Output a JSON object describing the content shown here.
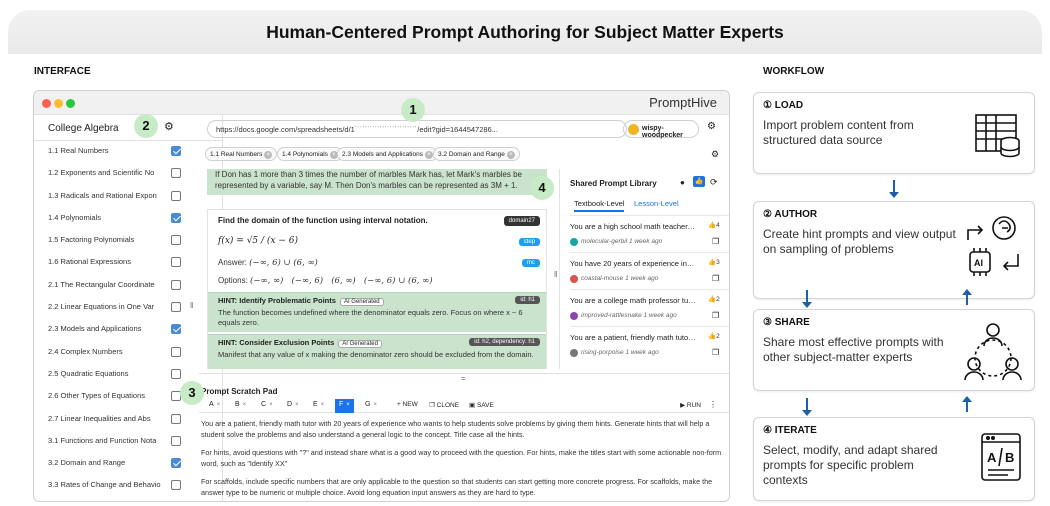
{
  "banner": {
    "title": "Human-Centered Prompt Authoring for Subject Matter Experts"
  },
  "sections": {
    "interface": "INTERFACE",
    "workflow": "WORKFLOW"
  },
  "app": {
    "brand": "PromptHive",
    "url": "https://docs.google.com/spreadsheets/d/1˙˙˙˙˙˙˙˙˙˙˙˙˙˙˙˙˙˙˙˙˙˙˙˙˙/edit?gid=1644547286...",
    "user": "wispy-woodpecker",
    "colors": {
      "accent": "#1a73e8",
      "hint_bg": "#c9e3cc",
      "badge": "#c7ebc7"
    }
  },
  "badges": [
    "1",
    "2",
    "3",
    "4"
  ],
  "sidebar": {
    "title": "College Algebra",
    "items": [
      {
        "label": "1.1 Real Numbers",
        "checked": true
      },
      {
        "label": "1.2 Exponents and Scientific No",
        "checked": false
      },
      {
        "label": "1.3 Radicals and Rational Expon",
        "checked": false
      },
      {
        "label": "1.4 Polynomials",
        "checked": true
      },
      {
        "label": "1.5 Factoring Polynomials",
        "checked": false
      },
      {
        "label": "1.6 Rational Expressions",
        "checked": false
      },
      {
        "label": "2.1 The Rectangular Coordinate",
        "checked": false
      },
      {
        "label": "2.2 Linear Equations in One Var",
        "checked": false
      },
      {
        "label": "2.3 Models and Applications",
        "checked": true
      },
      {
        "label": "2.4 Complex Numbers",
        "checked": false
      },
      {
        "label": "2.5 Quadratic Equations",
        "checked": false
      },
      {
        "label": "2.6 Other Types of Equations",
        "checked": false
      },
      {
        "label": "2.7 Linear Inequalities and Abs",
        "checked": false
      },
      {
        "label": "3.1 Functions and Function Nota",
        "checked": false
      },
      {
        "label": "3.2 Domain and Range",
        "checked": true
      },
      {
        "label": "3.3 Rates of Change and Behavio",
        "checked": false
      },
      {
        "label": "3.4 Composition of Functions",
        "checked": false
      }
    ]
  },
  "tabs": [
    "1.1 Real Numbers",
    "1.4 Polynomials",
    "2.3 Models and Applications",
    "3.2 Domain and Range"
  ],
  "problem_prev": {
    "line1": "If Don has 1 more than 3 times the number of marbles Mark has, let Mark's marbles be",
    "line2": "represented by a variable, say M. Then Don's marbles can be represented as 3M + 1."
  },
  "problem": {
    "title": "Find the domain of the function using interval notation.",
    "id_tag": "domain27",
    "formula": "f(x) = √5 / (x − 6)",
    "step_tag": "step",
    "answer_label": "Answer:",
    "answer": "(−∞, 6) ∪ (6, ∞)",
    "mc_tag": "mc",
    "options_label": "Options:",
    "options": "(−∞, ∞)   (−∞, 6)   (6, ∞)   (−∞, 6) ∪ (6, ∞)"
  },
  "hints": [
    {
      "title": "HINT: Identify Problematic Points",
      "tag": "AI Generated",
      "id": "id: h1",
      "body": "The function becomes undefined where the denominator equals zero. Focus on where x − 6 equals zero."
    },
    {
      "title": "HINT: Consider Exclusion Points",
      "tag": "AI Generated",
      "id": "id: h2, dependency: h1",
      "body": "Manifest that any value of x making the denominator zero should be excluded from the domain."
    }
  ],
  "library": {
    "title": "Shared Prompt Library",
    "tabs": [
      "Textbook-Level",
      "Lesson-Level"
    ],
    "rows": [
      {
        "text": "You are a high school math teacher. If you ...",
        "likes": "4",
        "author": "molecular-gerbil",
        "time": "1 week ago",
        "avatar": "#1aa3a3"
      },
      {
        "text": "You have 20 years of experience in teachi...",
        "likes": "3",
        "author": "coastal-mouse",
        "time": "1 week ago",
        "avatar": "#d9534f"
      },
      {
        "text": "You are a college math professor tutoring ...",
        "likes": "2",
        "author": "improved-rattlesnake",
        "time": "1 week ago",
        "avatar": "#8e44ad"
      },
      {
        "text": "You are a patient, friendly math tutor with ...",
        "likes": "2",
        "author": "rising-porpoise",
        "time": "1 week ago",
        "avatar": "#777777"
      }
    ]
  },
  "scratch": {
    "title": "Prompt Scratch Pad",
    "tabs": [
      "A",
      "B",
      "C",
      "D",
      "E",
      "F",
      "G"
    ],
    "active_tab": "F",
    "actions": {
      "new": "NEW",
      "clone": "CLONE",
      "save": "SAVE",
      "run": "RUN"
    },
    "paragraphs": [
      "You are a patient, friendly math tutor with 20 years of experience who wants to help students solve problems by giving them hints. Generate hints that will help a student solve the problems and also understand a general logic to the concept. Title case all the hints.",
      "For hints, avoid questions with \"?\" and instead share what is a good way to proceed with the question. For hints, make the titles start with some actionable non-form word, such as \"Identify XX\"",
      "For scaffolds, include specific numbers that are only applicable to the question so that students can start getting more concrete progress. For scaffolds, make the answer type to be numeric or multiple choice. Avoid long equation input answers as they are hard to type."
    ]
  },
  "workflow": [
    {
      "head": "① LOAD",
      "desc": "Import problem content from structured data source",
      "icon": "database-table-icon"
    },
    {
      "head": "② AUTHOR",
      "desc": "Create hint prompts and view output on sampling of problems",
      "icon": "ai-brain-cycle-icon"
    },
    {
      "head": "③ SHARE",
      "desc": "Share most effective prompts with other subject-matter experts",
      "icon": "people-network-icon"
    },
    {
      "head": "④ ITERATE",
      "desc": "Select, modify, and adapt shared prompts for specific problem contexts",
      "icon": "ab-test-document-icon"
    }
  ]
}
